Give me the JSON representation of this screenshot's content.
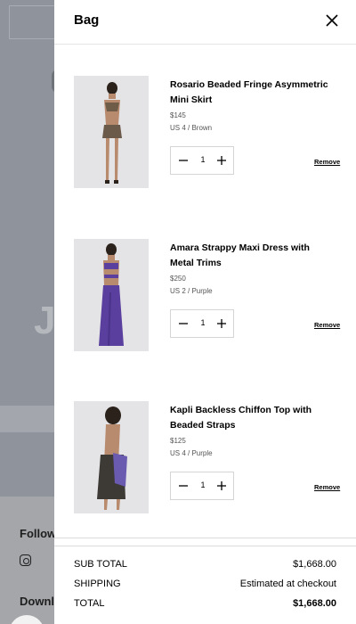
{
  "drawer": {
    "title": "Bag"
  },
  "items": [
    {
      "name": "Rosario Beaded Fringe Asymmetric Mini Skirt",
      "price": "$145",
      "variant": "US 4 / Brown",
      "quantity": "1",
      "remove_label": "Remove"
    },
    {
      "name": "Amara Strappy Maxi Dress with Metal Trims",
      "price": "$250",
      "variant": "US 2 / Purple",
      "quantity": "1",
      "remove_label": "Remove"
    },
    {
      "name": "Kapli Backless Chiffon Top with Beaded Straps",
      "price": "$125",
      "variant": "US 4 / Purple",
      "quantity": "1",
      "remove_label": "Remove"
    }
  ],
  "summary": {
    "subtotal_label": "SUB TOTAL",
    "subtotal_value": "$1,668.00",
    "shipping_label": "SHIPPING",
    "shipping_value": "Estimated at checkout",
    "total_label": "TOTAL",
    "total_value": "$1,668.00"
  },
  "background": {
    "big_letter": "J",
    "follow_label": "Follow",
    "download_label": "Downlo"
  },
  "colors": {
    "overlay": "#8f949c",
    "drawer_bg": "#ffffff",
    "text": "#000000",
    "skirt_item_color": "#6b5a4a",
    "dress_item_color": "#5a3f9e",
    "top_item_color": "#3d3a36"
  },
  "icons": {
    "close": "close-icon",
    "minus": "minus-icon",
    "plus": "plus-icon",
    "instagram": "instagram-icon"
  }
}
